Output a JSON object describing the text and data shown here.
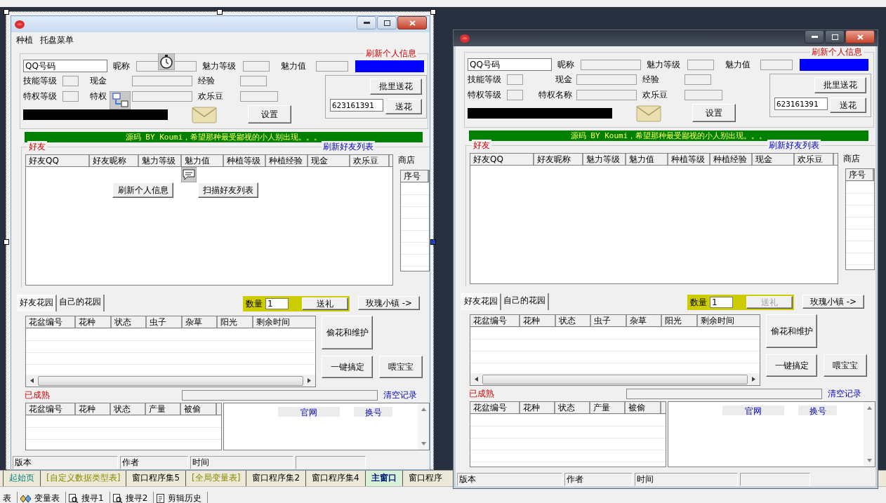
{
  "ide": {
    "doc_tabs": [
      {
        "label": "起始页",
        "kind": "start",
        "selected": false
      },
      {
        "label": "[自定义数据类型表]",
        "kind": "table",
        "selected": false
      },
      {
        "label": "窗口程序集5",
        "kind": "code",
        "selected": false
      },
      {
        "label": "[全局变量表]",
        "kind": "table",
        "selected": false
      },
      {
        "label": "窗口程序集2",
        "kind": "code",
        "selected": false
      },
      {
        "label": "窗口程序集4",
        "kind": "code",
        "selected": false
      },
      {
        "label": "主窗口",
        "kind": "code",
        "selected": true
      },
      {
        "label": "窗口程序",
        "kind": "code",
        "selected": false
      }
    ],
    "tool_tabs": [
      {
        "label": "表",
        "kind": "text"
      },
      {
        "label": "变量表",
        "kind": "variables"
      },
      {
        "label": "搜寻1",
        "kind": "search"
      },
      {
        "label": "搜寻2",
        "kind": "search"
      },
      {
        "label": "剪辑历史",
        "kind": "clipboard"
      }
    ]
  },
  "design_form": {
    "kind": "designer",
    "menu": [
      "种植",
      "托盘菜单"
    ],
    "info": {
      "title": "刷新个人信息",
      "qq_field": {
        "value": "QQ号码"
      },
      "labels": [
        "昵称",
        "魅力等级",
        "魅力值",
        "技能等级",
        "现金",
        "经验",
        "特权等级",
        "特权",
        "欢乐豆"
      ],
      "settings_button": "设置",
      "batch_button": "批里送花",
      "flower_qq": {
        "value": "623161391"
      },
      "flower_button": "送花"
    },
    "banner": "源码 BY Koumi，希望那种最受鄙视的小人别出现。。。",
    "friends": {
      "title": "好友",
      "refresh_link": "刷新好友列表",
      "columns": [
        "好友QQ",
        "好友昵称",
        "魅力等级",
        "魅力值",
        "种植等级",
        "种植经验",
        "现金",
        "欢乐豆"
      ],
      "shop_label": "商店",
      "shop_columns": [
        "序号"
      ]
    },
    "overlay_buttons": [
      "刷新个人信息",
      "扫描好友列表"
    ],
    "garden_tabs": [
      {
        "label": "好友花园",
        "selected": true
      },
      {
        "label": "自己的花园",
        "selected": false
      }
    ],
    "gift": {
      "quantity_label": "数量",
      "quantity": "1",
      "button": "送礼",
      "disabled": false
    },
    "town_button": "玫瑰小镇 ->",
    "garden_columns": [
      "花盆编号",
      "花种",
      "状态",
      "虫子",
      "杂草",
      "阳光",
      "剩余时间"
    ],
    "actions": [
      "偷花和维护",
      "一键搞定",
      "喂宝宝"
    ],
    "ripe_label": "已成熟",
    "ripe_progress": {
      "level": 0
    },
    "clear_link": "清空记录",
    "ripe_columns": [
      "花盆编号",
      "花种",
      "状态",
      "产量",
      "被偷"
    ],
    "log_links": [
      "官网",
      "换号"
    ],
    "status_bar": [
      "版本",
      "作者",
      "时间"
    ]
  },
  "running_window": {
    "kind": "running",
    "info": {
      "title": "刷新个人信息",
      "qq_field": {
        "value": "QQ号码"
      },
      "labels": [
        "昵称",
        "魅力等级",
        "魅力值",
        "技能等级",
        "现金",
        "经验",
        "特权等级",
        "特权名称",
        "欢乐豆"
      ],
      "settings_button": "设置",
      "batch_button": "批里送花",
      "flower_qq": {
        "value": "623161391"
      },
      "flower_button": "送花"
    },
    "banner": "源码 BY Koumi，希望那种最受鄙视的小人别出现。。。",
    "friends": {
      "title": "好友",
      "refresh_link": "刷新好友列表",
      "columns": [
        "好友QQ",
        "好友昵称",
        "魅力等级",
        "魅力值",
        "种植等级",
        "种植经验",
        "现金",
        "欢乐豆"
      ],
      "shop_label": "商店",
      "shop_columns": [
        "序号"
      ]
    },
    "garden_tabs": [
      {
        "label": "好友花园",
        "selected": true
      },
      {
        "label": "自己的花园",
        "selected": false
      }
    ],
    "gift": {
      "quantity_label": "数量",
      "quantity": "1",
      "button": "送礼",
      "disabled": true
    },
    "town_button": "玫瑰小镇 ->",
    "garden_columns": [
      "花盆编号",
      "花种",
      "状态",
      "虫子",
      "杂草",
      "阳光",
      "剩余时间"
    ],
    "actions": [
      "偷花和维护",
      "一键搞定",
      "喂宝宝"
    ],
    "ripe_label": "已成熟",
    "ripe_progress": {
      "level": 0
    },
    "clear_link": "清空记录",
    "ripe_columns": [
      "花盆编号",
      "花种",
      "状态",
      "产量",
      "被偷"
    ],
    "log_links": [
      "官网",
      "换号"
    ],
    "status_bar": [
      "版本",
      "作者",
      "时间"
    ]
  }
}
